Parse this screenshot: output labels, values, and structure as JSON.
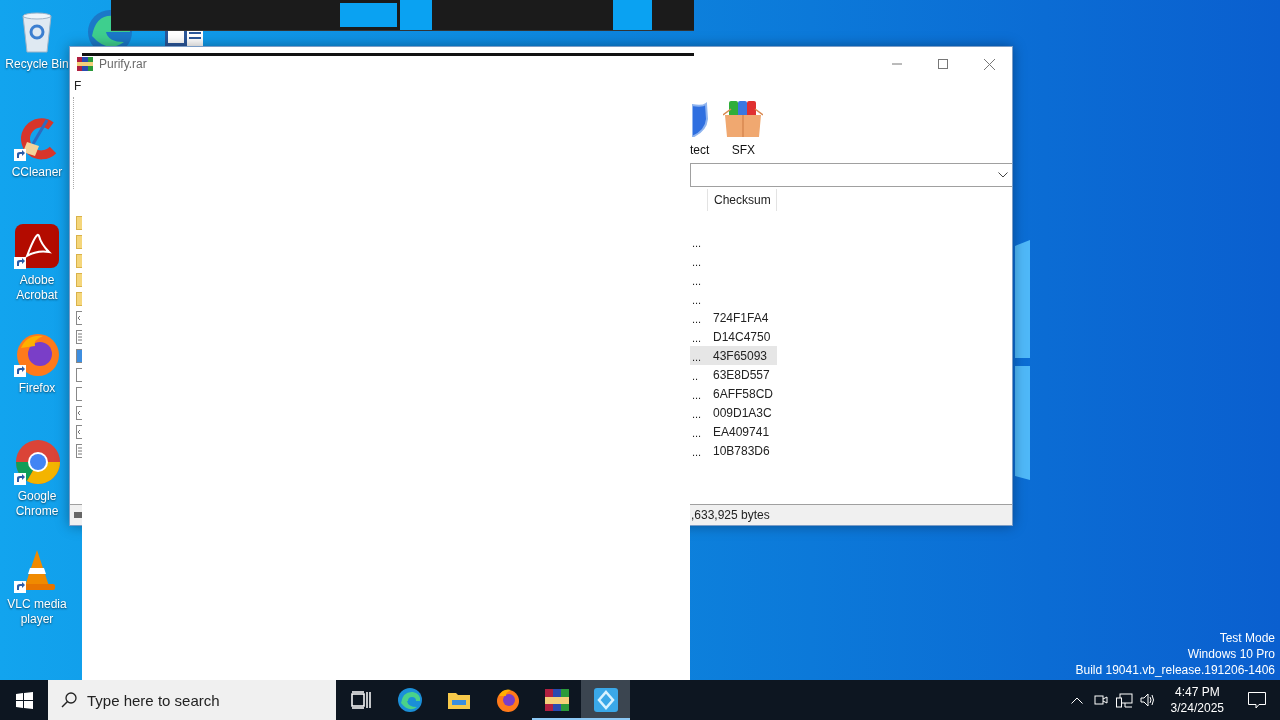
{
  "desktop": {
    "icons": [
      {
        "kind": "recycle",
        "label": "Recycle Bin"
      },
      {
        "kind": "ccleaner",
        "label": "CCleaner"
      },
      {
        "kind": "acrobat",
        "label": "Adobe Acrobat"
      },
      {
        "kind": "firefox",
        "label": "Firefox"
      },
      {
        "kind": "chrome",
        "label": "Google Chrome"
      },
      {
        "kind": "vlc",
        "label": "VLC media player"
      }
    ]
  },
  "archive_window": {
    "title": "Purify.rar",
    "menu": "F",
    "toolbar": [
      {
        "kind": "protect",
        "label": "tect"
      },
      {
        "kind": "sfx",
        "label": "SFX"
      }
    ],
    "columns": {
      "checksum": "Checksum"
    },
    "rows": [
      {
        "kind": "folder",
        "selected": false
      },
      {
        "kind": "folder",
        "column_2": "...",
        "selected": false
      },
      {
        "kind": "folder",
        "column_2": "...",
        "selected": false
      },
      {
        "kind": "folder",
        "column_2": "...",
        "selected": false
      },
      {
        "kind": "folder",
        "column_2": "...",
        "selected": false
      },
      {
        "kind": "code",
        "column_2": "...",
        "checksum": "724F1FA4",
        "selected": false
      },
      {
        "kind": "text",
        "column_2": "...",
        "checksum": "D14C4750",
        "selected": false
      },
      {
        "kind": "blank",
        "column_2": "...",
        "checksum": "43F65093",
        "selected": true
      },
      {
        "kind": "blank",
        "column_2": "..",
        "checksum": "63E8D557",
        "selected": false
      },
      {
        "kind": "blank",
        "column_2": "...",
        "checksum": "6AFF58CD",
        "selected": false
      },
      {
        "kind": "code",
        "column_2": "...",
        "checksum": "009D1A3C",
        "selected": false
      },
      {
        "kind": "code",
        "column_2": "...",
        "checksum": "EA409741",
        "selected": false
      },
      {
        "kind": "text",
        "column_2": "...",
        "checksum": "10B783D6",
        "selected": false
      }
    ],
    "status": ",633,925 bytes"
  },
  "taskbar": {
    "search": {
      "placeholder": "Type here to search"
    },
    "apps": [
      {
        "kind": "taskview",
        "open": false,
        "selected": false
      },
      {
        "kind": "edge",
        "open": false,
        "selected": false
      },
      {
        "kind": "explorer",
        "open": false,
        "selected": false
      },
      {
        "kind": "firefox",
        "open": false,
        "selected": false
      },
      {
        "kind": "winrar",
        "open": true,
        "selected": false
      },
      {
        "kind": "app",
        "open": true,
        "selected": true
      }
    ],
    "time": "4:47 PM",
    "date": "3/24/2025"
  },
  "os_watermark": [
    "Test Mode",
    "Windows 10 Pro",
    "Build 19041.vb_release.191206-1406"
  ]
}
